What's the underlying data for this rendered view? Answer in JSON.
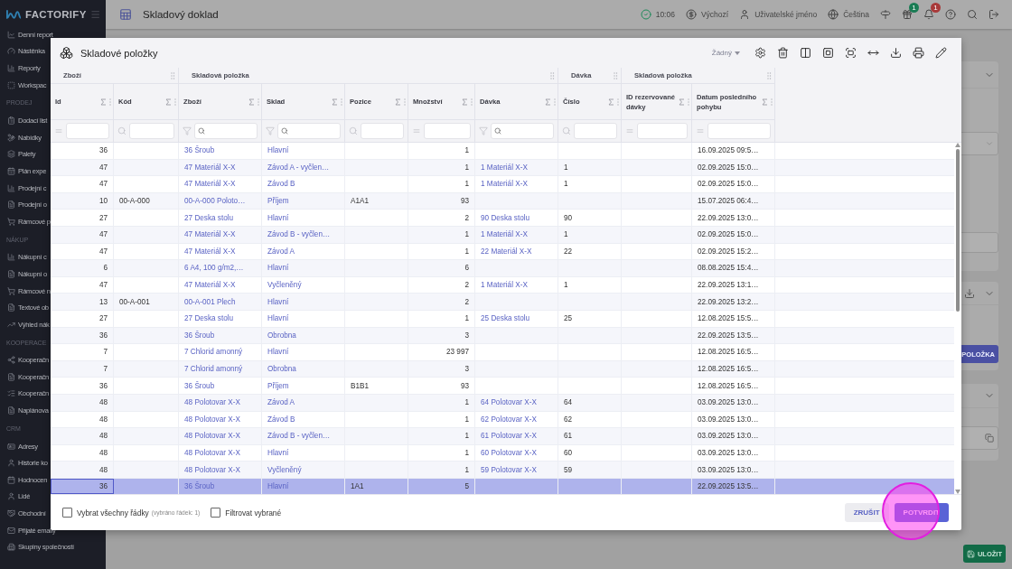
{
  "sidebar": {
    "logo": "FACTORIFY",
    "sections": [
      {
        "items": [
          "Denní report",
          "Nástěnka",
          "Reporty",
          "Workspac"
        ]
      },
      {
        "heading": "PRODEJ",
        "items": [
          "Dodací list",
          "Nabídky",
          "Palety",
          "Plán expe",
          "Prodejní c",
          "Prodejní o",
          "Rámcové p"
        ]
      },
      {
        "heading": "NÁKUP",
        "items": [
          "Nákupní c",
          "Nákupní o",
          "Rámcové n",
          "Textové ob",
          "Výhled nák"
        ]
      },
      {
        "heading": "KOOPERACE",
        "items": [
          "Kooperačn",
          "Kooperačn",
          "Kooperačn",
          "Naplánova"
        ]
      },
      {
        "heading": "CRM",
        "items": [
          "Adresy",
          "Historie ko",
          "Hodnocen",
          "Lidé",
          "Obchodní",
          "Přijaté emaily",
          "Skupiny společností"
        ]
      }
    ]
  },
  "topbar": {
    "title": "Skladový doklad",
    "time": "10:06",
    "currency": "Výchozí",
    "user": "Uživatelské jméno",
    "language": "Čeština",
    "gift_badge": "1",
    "notification_badge": "1"
  },
  "page": {
    "add_button": "POLOŽKA",
    "save_button": "ULOŽIT"
  },
  "modal": {
    "title": "Skladové položky",
    "view_select": "Žádný",
    "column_groups": [
      {
        "label": "Zboží",
        "columns": [
          {
            "label": "Id",
            "kind": "number",
            "filter": {
              "kind": "equals"
            }
          },
          {
            "label": "Kód",
            "kind": "text",
            "filter": {
              "kind": "search"
            }
          }
        ]
      },
      {
        "label": "Skladová položka",
        "columns": [
          {
            "label": "Zboží",
            "kind": "link",
            "filter": {
              "kind": "filter"
            }
          },
          {
            "label": "Sklad",
            "kind": "link",
            "filter": {
              "kind": "filter"
            }
          },
          {
            "label": "Pozice",
            "kind": "text",
            "filter": {
              "kind": "search"
            }
          },
          {
            "label": "Množství",
            "kind": "number",
            "filter": {
              "kind": "equals"
            }
          },
          {
            "label": "Dávka",
            "kind": "link",
            "filter": {
              "kind": "filter"
            }
          }
        ]
      },
      {
        "label": "Dávka",
        "columns": [
          {
            "label": "Číslo",
            "kind": "text",
            "filter": {
              "kind": "search"
            }
          }
        ]
      },
      {
        "label": "Skladová položka",
        "columns": [
          {
            "label": "ID rezervované dávky",
            "kind": "text",
            "filter": {
              "kind": "equals"
            }
          },
          {
            "label": "Datum posledního pohybu",
            "kind": "text",
            "filter": {
              "kind": "equals"
            }
          }
        ]
      }
    ],
    "rows": [
      {
        "cells": [
          "36",
          "",
          "36 Šroub",
          "Hlavní",
          "",
          "1",
          "",
          "",
          "",
          "16.09.2025 09:5…"
        ],
        "selected": false
      },
      {
        "cells": [
          "47",
          "",
          "47 Materiál X-X",
          "Závod A - vyčlen…",
          "",
          "1",
          "1 Materiál X-X",
          "1",
          "",
          "02.09.2025 15:0…"
        ],
        "selected": false
      },
      {
        "cells": [
          "47",
          "",
          "47 Materiál X-X",
          "Závod B",
          "",
          "1",
          "1 Materiál X-X",
          "1",
          "",
          "02.09.2025 15:0…"
        ],
        "selected": false
      },
      {
        "cells": [
          "10",
          "00-A-000",
          "00-A-000 Poloto…",
          "Příjem",
          "A1A1",
          "93",
          "",
          "",
          "",
          "15.07.2025 06:4…"
        ],
        "selected": false
      },
      {
        "cells": [
          "27",
          "",
          "27 Deska stolu",
          "Hlavní",
          "",
          "2",
          "90 Deska stolu",
          "90",
          "",
          "22.09.2025 13:0…"
        ],
        "selected": false
      },
      {
        "cells": [
          "47",
          "",
          "47 Materiál X-X",
          "Závod B - vyčlen…",
          "",
          "1",
          "1 Materiál X-X",
          "1",
          "",
          "02.09.2025 15:0…"
        ],
        "selected": false
      },
      {
        "cells": [
          "47",
          "",
          "47 Materiál X-X",
          "Závod A",
          "",
          "1",
          "22 Materiál X-X",
          "22",
          "",
          "02.09.2025 15:2…"
        ],
        "selected": false
      },
      {
        "cells": [
          "6",
          "",
          "6 A4, 100 g/m2,…",
          "Hlavní",
          "",
          "6",
          "",
          "",
          "",
          "08.08.2025 15:4…"
        ],
        "selected": false
      },
      {
        "cells": [
          "47",
          "",
          "47 Materiál X-X",
          "Vyčleněný",
          "",
          "2",
          "1 Materiál X-X",
          "1",
          "",
          "22.09.2025 13:1…"
        ],
        "selected": false
      },
      {
        "cells": [
          "13",
          "00-A-001",
          "00-A-001 Plech",
          "Hlavní",
          "",
          "2",
          "",
          "",
          "",
          "22.09.2025 13:2…"
        ],
        "selected": false
      },
      {
        "cells": [
          "27",
          "",
          "27 Deska stolu",
          "Hlavní",
          "",
          "1",
          "25 Deska stolu",
          "25",
          "",
          "12.08.2025 15:5…"
        ],
        "selected": false
      },
      {
        "cells": [
          "36",
          "",
          "36 Šroub",
          "Obrobna",
          "",
          "3",
          "",
          "",
          "",
          "22.09.2025 13:5…"
        ],
        "selected": false
      },
      {
        "cells": [
          "7",
          "",
          "7 Chlorid amonný",
          "Hlavní",
          "",
          "23 997",
          "",
          "",
          "",
          "12.08.2025 16:5…"
        ],
        "selected": false
      },
      {
        "cells": [
          "7",
          "",
          "7 Chlorid amonný",
          "Obrobna",
          "",
          "3",
          "",
          "",
          "",
          "12.08.2025 16:5…"
        ],
        "selected": false
      },
      {
        "cells": [
          "36",
          "",
          "36 Šroub",
          "Příjem",
          "B1B1",
          "93",
          "",
          "",
          "",
          "12.08.2025 16:5…"
        ],
        "selected": false
      },
      {
        "cells": [
          "48",
          "",
          "48 Polotovar X-X",
          "Závod A",
          "",
          "1",
          "64 Polotovar X-X",
          "64",
          "",
          "03.09.2025 13:0…"
        ],
        "selected": false
      },
      {
        "cells": [
          "48",
          "",
          "48 Polotovar X-X",
          "Závod B",
          "",
          "1",
          "62 Polotovar X-X",
          "62",
          "",
          "03.09.2025 13:0…"
        ],
        "selected": false
      },
      {
        "cells": [
          "48",
          "",
          "48 Polotovar X-X",
          "Závod B - vyčlen…",
          "",
          "1",
          "61 Polotovar X-X",
          "61",
          "",
          "03.09.2025 13:0…"
        ],
        "selected": false
      },
      {
        "cells": [
          "48",
          "",
          "48 Polotovar X-X",
          "Hlavní",
          "",
          "1",
          "60 Polotovar X-X",
          "60",
          "",
          "03.09.2025 13:0…"
        ],
        "selected": false
      },
      {
        "cells": [
          "48",
          "",
          "48 Polotovar X-X",
          "Vyčleněný",
          "",
          "1",
          "59 Polotovar X-X",
          "59",
          "",
          "03.09.2025 13:0…"
        ],
        "selected": false
      },
      {
        "cells": [
          "36",
          "",
          "36 Šroub",
          "Hlavní",
          "1A1",
          "5",
          "",
          "",
          "",
          "22.09.2025 13:5…"
        ],
        "selected": true
      }
    ],
    "footer": {
      "select_all": {
        "label": "Vybrat všechny řádky",
        "note": "(vybráno řádek: 1)",
        "checked": false
      },
      "filter_selected": {
        "label": "Filtrovat vybrané",
        "checked": false
      },
      "buttons": [
        {
          "label": "ZRUŠIT",
          "kind": "secondary"
        },
        {
          "label": "POTVRDIT",
          "kind": "primary"
        }
      ]
    }
  }
}
